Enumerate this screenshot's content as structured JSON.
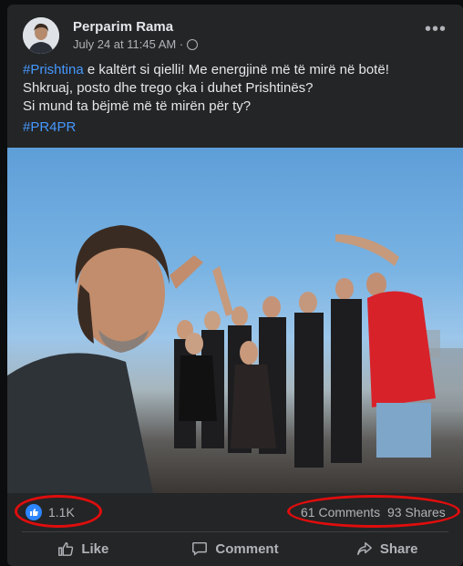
{
  "post": {
    "author": "Perparim Rama",
    "timestamp": "July 24 at 11:45 AM",
    "separator": "·",
    "privacy_icon": "globe-icon",
    "more_icon": "ellipsis-icon",
    "text_lines": [
      {
        "tag": "#Prishtina",
        "rest": " e kaltërt si qielli! Me energjinë më të mirë në botë!"
      },
      {
        "text": "Shkruaj, posto dhe trego çka i duhet Prishtinës?"
      },
      {
        "text": "Si mund ta bëjmë më të mirën për ty?"
      }
    ],
    "hashtag": "#PR4PR"
  },
  "stats": {
    "reaction_icon": "like-icon",
    "likes": "1.1K",
    "comments": "61 Comments",
    "shares": "93 Shares"
  },
  "actions": {
    "like": "Like",
    "comment": "Comment",
    "share": "Share"
  },
  "colors": {
    "card_bg": "#242526",
    "text": "#e4e6eb",
    "muted": "#b0b3b8",
    "link": "#4599ff",
    "like_blue": "#2d86ff",
    "annotation_red": "#e00d0d"
  }
}
